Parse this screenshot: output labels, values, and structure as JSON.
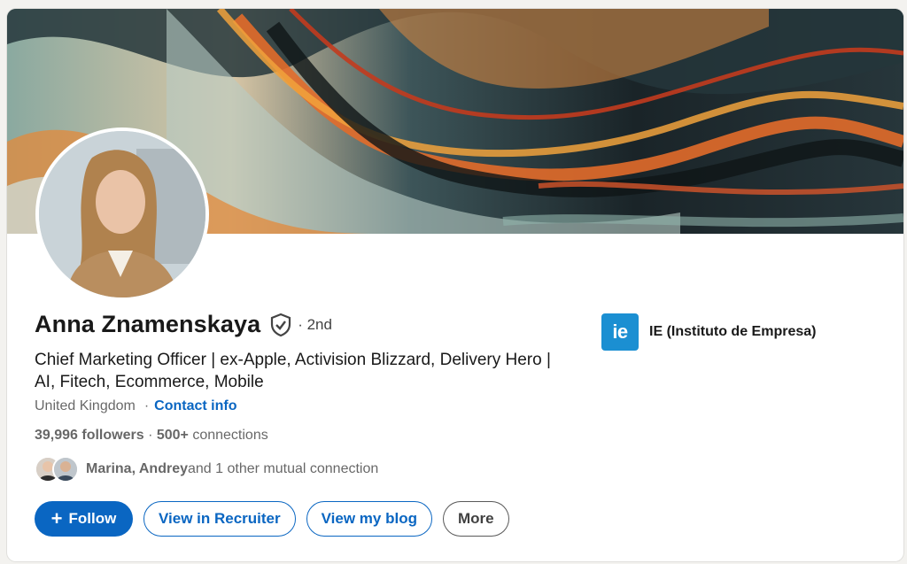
{
  "profile": {
    "name": "Anna Znamenskaya",
    "verified_icon": "verified-shield-icon",
    "degree": "· 2nd",
    "headline": "Chief Marketing Officer | ex-Apple, Activision Blizzard, Delivery Hero | AI, Fitech, Ecommerce, Mobile",
    "location": "United Kingdom",
    "contact_link": "Contact info",
    "followers": "39,996 followers",
    "separator": " · ",
    "connections": "500+",
    "connections_suffix": " connections",
    "mutual": {
      "names": "Marina, Andrey",
      "rest": " and 1 other mutual connection"
    }
  },
  "education": {
    "logo_text": "ie",
    "name": "IE (Instituto de Empresa)"
  },
  "actions": {
    "follow": "Follow",
    "recruiter": "View in Recruiter",
    "blog": "View my blog",
    "more": "More"
  },
  "colors": {
    "primary": "#0a66c2",
    "edu_logo": "#1b8fd2"
  }
}
